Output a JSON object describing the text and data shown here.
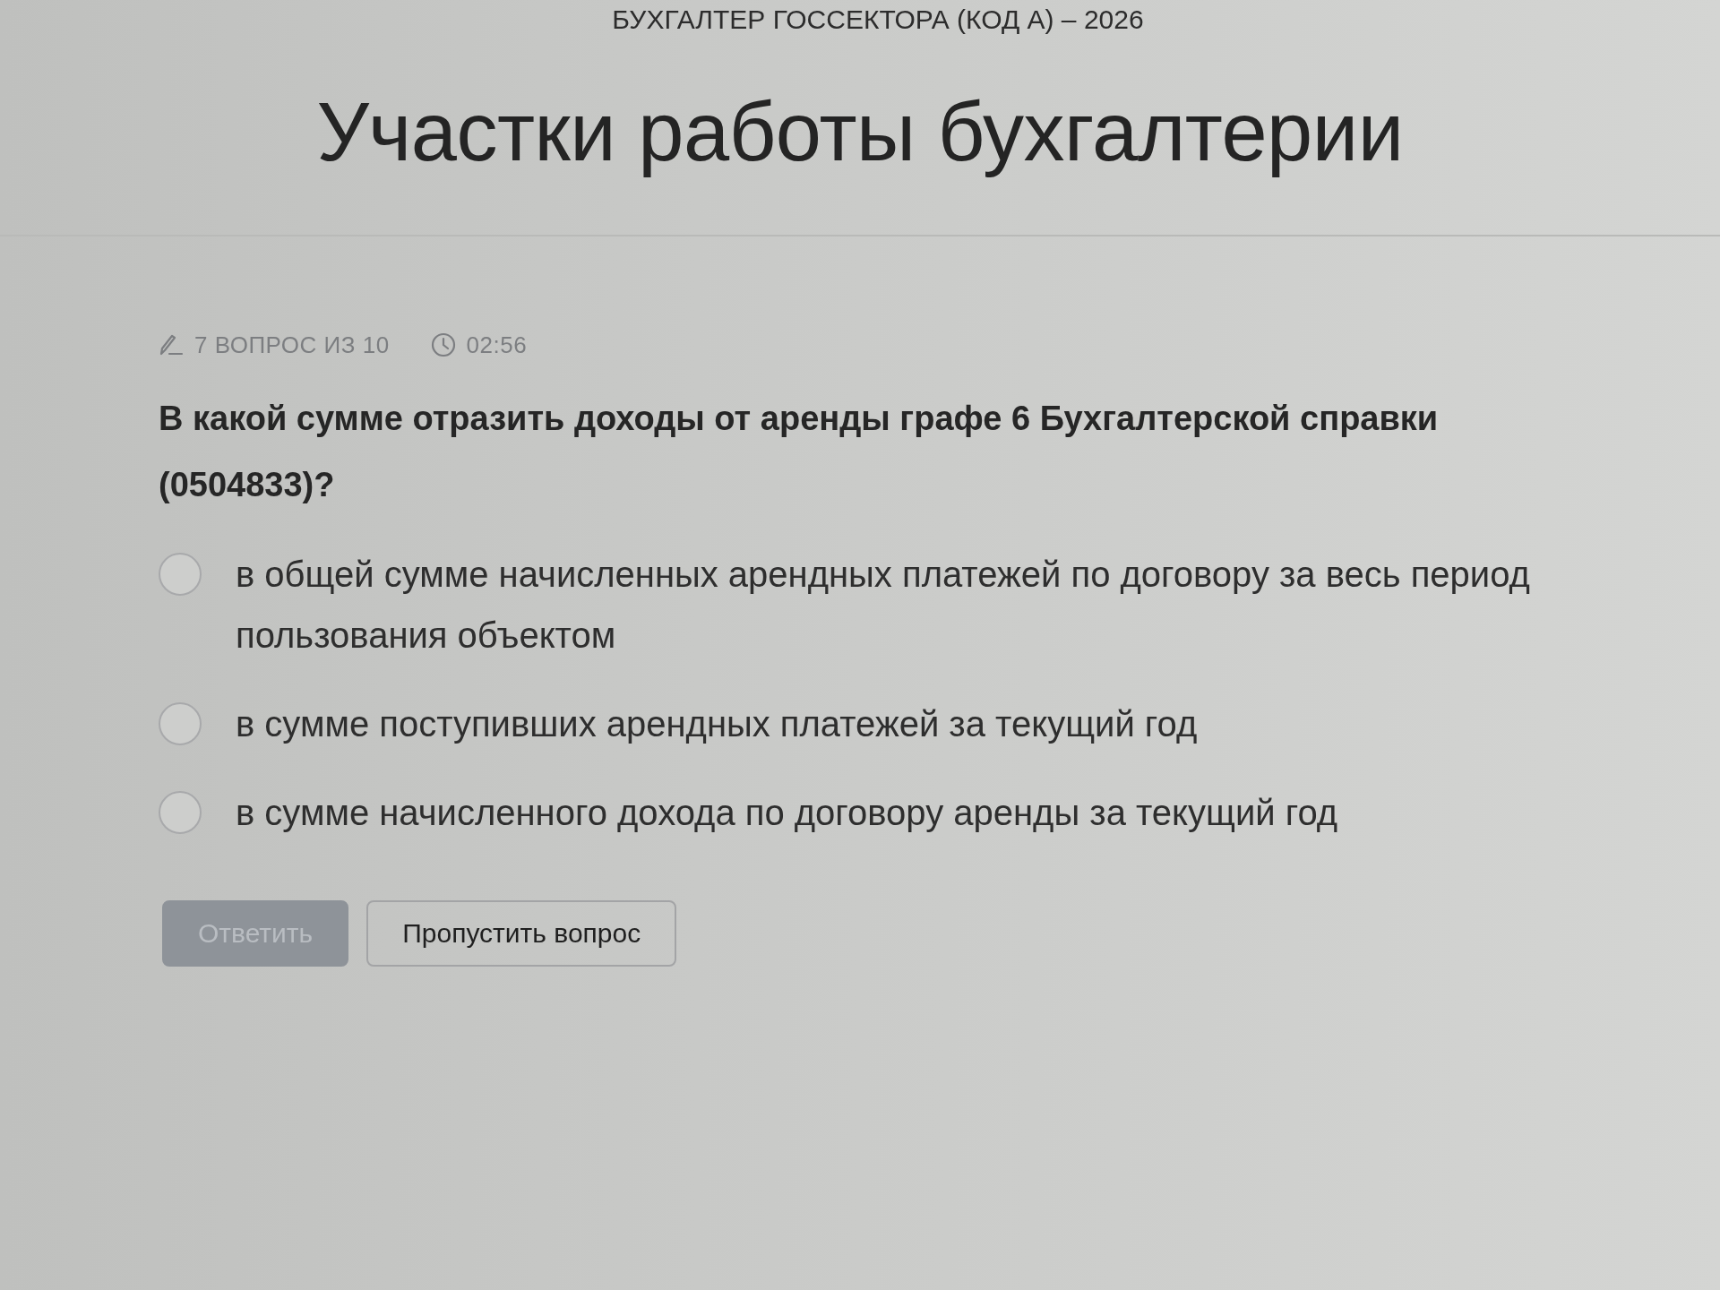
{
  "header": {
    "subtitle": "БУХГАЛТЕР ГОССЕКТОРА (КОД А) – 2026",
    "title": "Участки работы бухгалтерии"
  },
  "quiz": {
    "progress": "7 ВОПРОС ИЗ 10",
    "timer": "02:56",
    "question": "В какой сумме отразить доходы от аренды графе 6 Бухгалтерской справки (0504833)?",
    "options": [
      {
        "label": "в общей сумме начисленных арендных платежей по договору за весь период пользования объектом",
        "selected": false
      },
      {
        "label": "в сумме поступивших арендных платежей за текущий год",
        "selected": false
      },
      {
        "label": "в сумме начисленного дохода по договору аренды за текущий год",
        "selected": false
      }
    ],
    "buttons": [
      {
        "label": "Ответить",
        "kind": "primary",
        "disabled": true
      },
      {
        "label": "Пропустить вопрос",
        "kind": "secondary",
        "disabled": false
      }
    ]
  }
}
